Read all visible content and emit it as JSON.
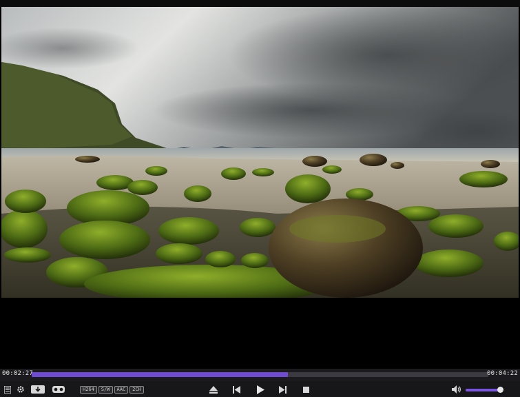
{
  "player": {
    "current_time": "00:02:27",
    "duration": "00:04:22",
    "progress_fraction": 0.561,
    "volume_fraction": 0.93,
    "badges": [
      "H264",
      "S/W",
      "AAC",
      "2CH"
    ]
  },
  "icons": {
    "menu": "menu-icon",
    "settings": "gear-icon",
    "download": "download-icon",
    "vr": "vr-headset-icon",
    "eject": "eject-icon",
    "previous": "previous-icon",
    "play": "play-icon",
    "next": "next-icon",
    "stop": "stop-icon",
    "volume": "speaker-icon"
  },
  "colors": {
    "accent": "#6e4bd0",
    "background": "#000000",
    "control_bar": "#17171a"
  }
}
